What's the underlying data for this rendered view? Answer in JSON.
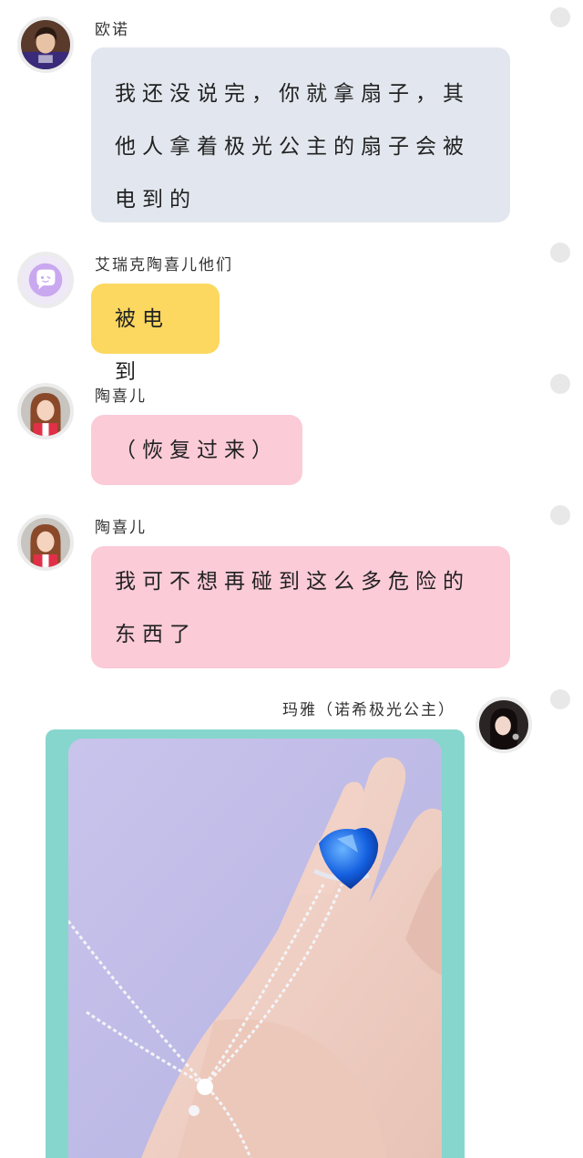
{
  "messages": [
    {
      "sender": "欧诺",
      "text": "我还没说完，你就拿扇子，其他人拿着极光公主的扇子会被电到的",
      "avatar": "boy-avatar"
    },
    {
      "sender": "艾瑞克陶喜儿他们",
      "text": "被电到",
      "avatar": "chat-bubble-avatar"
    },
    {
      "sender": "陶喜儿",
      "text": "（恢复过来）",
      "avatar": "girl-avatar"
    },
    {
      "sender": "陶喜儿",
      "text": "我可不想再碰到这么多危险的东西了",
      "avatar": "girl-avatar"
    },
    {
      "sender": "玛雅（诺希极光公主）",
      "avatar": "woman-avatar",
      "image": "hand-ring-photo"
    }
  ],
  "colors": {
    "gray_bubble": "#e2e7ef",
    "yellow_bubble": "#fcd860",
    "pink_bubble": "#fbcbd8",
    "image_frame": "#86d6cd",
    "purple_icon": "#c9a8f0"
  }
}
